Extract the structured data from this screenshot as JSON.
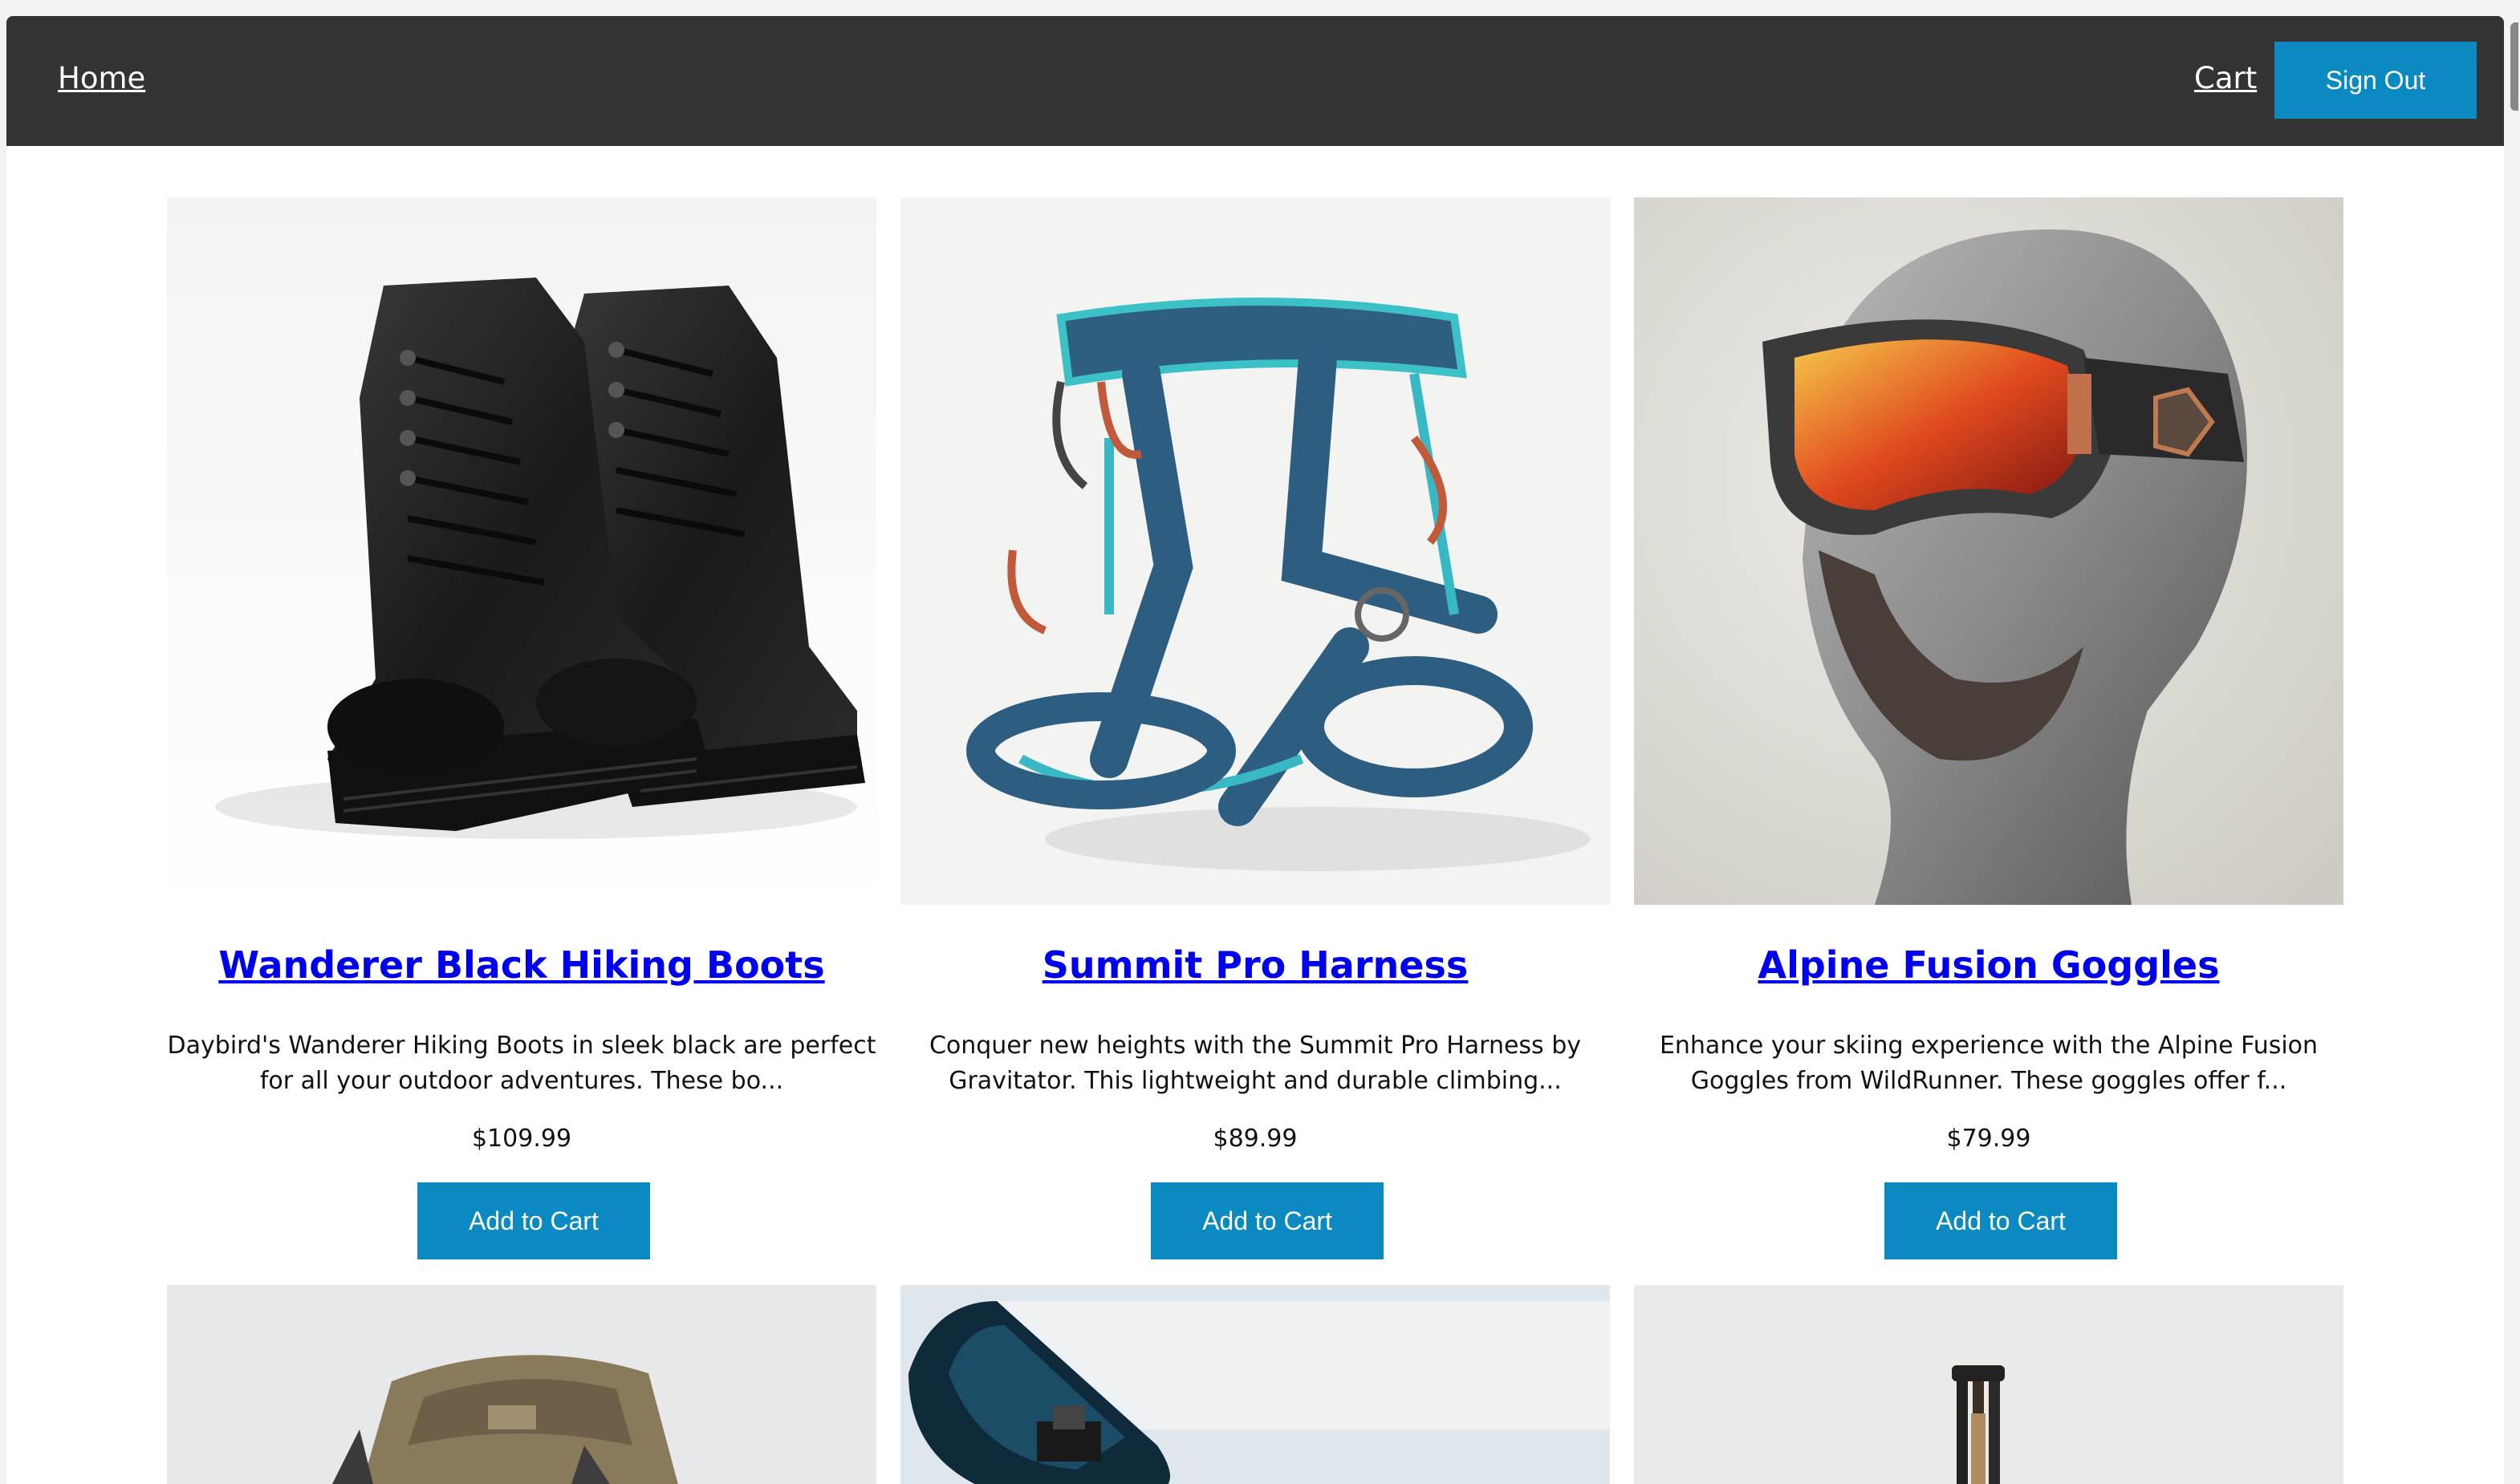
{
  "nav": {
    "home_label": "Home",
    "cart_label": "Cart",
    "signout_label": "Sign Out"
  },
  "colors": {
    "navbar_bg": "#333333",
    "button_bg": "#0a8ac0",
    "link": "#0000ee"
  },
  "products": [
    {
      "title": "Wanderer Black Hiking Boots",
      "description": "Daybird's Wanderer Hiking Boots in sleek black are perfect for all your outdoor adventures. These bo...",
      "price": "$109.99",
      "button": "Add to Cart",
      "image": "hiking-boots-photo"
    },
    {
      "title": "Summit Pro Harness",
      "description": "Conquer new heights with the Summit Pro Harness by Gravitator. This lightweight and durable climbing...",
      "price": "$89.99",
      "button": "Add to Cart",
      "image": "climbing-harness-photo"
    },
    {
      "title": "Alpine Fusion Goggles",
      "description": "Enhance your skiing experience with the Alpine Fusion Goggles from WildRunner. These goggles offer f...",
      "price": "$79.99",
      "button": "Add to Cart",
      "image": "ski-goggles-photo"
    }
  ],
  "partial_products": [
    {
      "image": "backpack-photo"
    },
    {
      "image": "snowboard-photo"
    },
    {
      "image": "trekking-poles-photo"
    }
  ]
}
